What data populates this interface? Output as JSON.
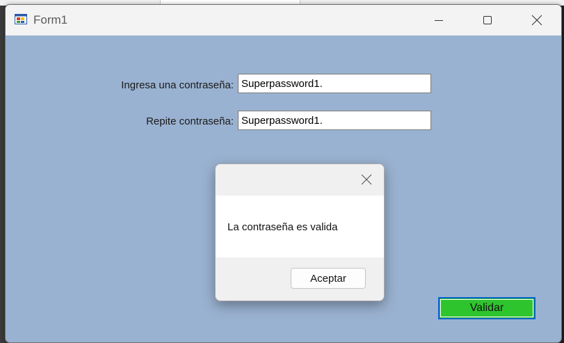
{
  "window": {
    "title": "Form1"
  },
  "form": {
    "password_label": "Ingresa una contraseña:",
    "password_value": "Superpassword1.",
    "repeat_label": "Repite contraseña:",
    "repeat_value": "Superpassword1.",
    "validate_button": "Validar"
  },
  "dialog": {
    "message": "La contraseña es valida",
    "ok_button": "Aceptar"
  },
  "colors": {
    "form_background": "#9ab2d1",
    "validate_button_bg": "#2ec42e",
    "validate_button_border": "#0a64c8"
  },
  "icons": {
    "app": "winforms-app-icon",
    "minimize": "minimize-icon",
    "maximize": "maximize-icon",
    "close": "close-icon",
    "dialog_close": "close-icon"
  }
}
